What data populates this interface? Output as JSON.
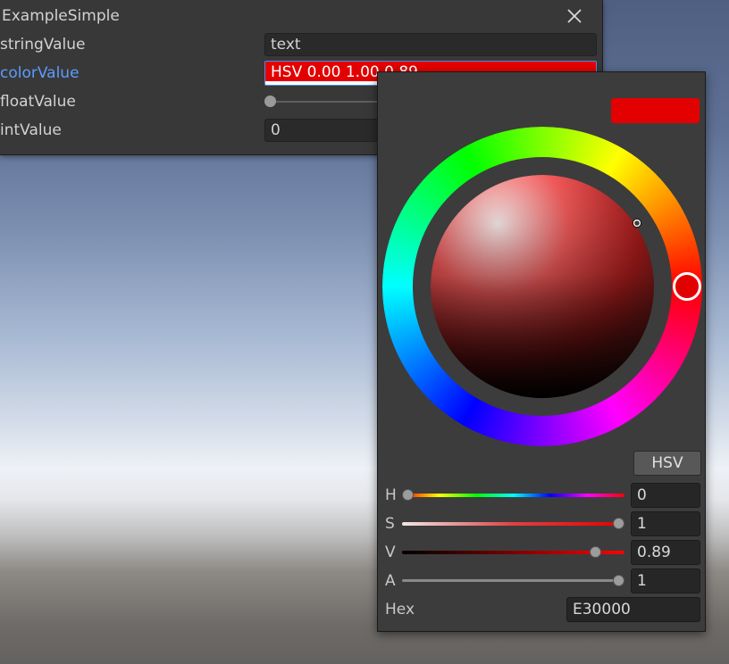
{
  "window": {
    "title": "ExampleSimple"
  },
  "fields": {
    "string": {
      "label": "stringValue",
      "value": "text"
    },
    "color": {
      "label": "colorValue",
      "value": "HSV 0.00 1.00 0.89",
      "swatch": "#E30000"
    },
    "float": {
      "label": "floatValue",
      "value": "0",
      "slider_fraction": 0
    },
    "int": {
      "label": "intValue",
      "value": "0"
    }
  },
  "picker": {
    "swatch_color": "#E30000",
    "mode_button": "HSV",
    "channels": [
      {
        "label": "H",
        "value": "0",
        "fraction": 0.0
      },
      {
        "label": "S",
        "value": "1",
        "fraction": 1.0
      },
      {
        "label": "V",
        "value": "0.89",
        "fraction": 0.89
      },
      {
        "label": "A",
        "value": "1",
        "fraction": 1.0
      }
    ],
    "hex_label": "Hex",
    "hex_value": "E30000"
  },
  "colors": {
    "panel_bg": "#383838",
    "accent_label": "#5C9CFF",
    "selected_color": "#E30000"
  }
}
